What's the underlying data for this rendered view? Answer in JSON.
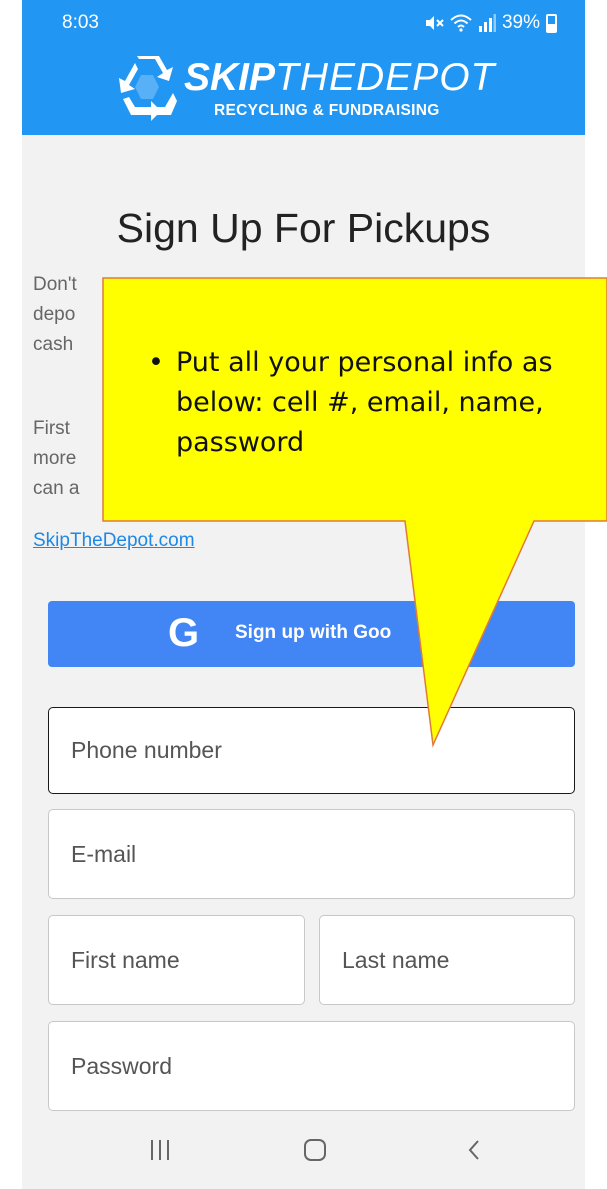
{
  "status_bar": {
    "time": "8:03",
    "battery": "39%"
  },
  "header": {
    "brand_bold": "SKIP",
    "brand_light": "THEDEPOT",
    "tagline": "RECYCLING & FUNDRAISING",
    "background": "#2196f3"
  },
  "page": {
    "title": "Sign Up For Pickups",
    "paragraph_1": "Don't",
    "paragraph_1_line_2": "depo",
    "paragraph_1_line_3": "cash",
    "paragraph_2_line_1": "First",
    "paragraph_2_line_2": "more",
    "paragraph_2_line_3": "can a",
    "link_text": "SkipTheDepot.com"
  },
  "google_button": {
    "icon": "G",
    "label": "Sign up with Goo"
  },
  "form": {
    "phone_placeholder": "Phone number",
    "email_placeholder": "E-mail",
    "first_name_placeholder": "First name",
    "last_name_placeholder": "Last name",
    "password_placeholder": "Password"
  },
  "navbar": {
    "recent_icon": "recent-apps-icon",
    "home_icon": "home-icon",
    "back_icon": "back-icon",
    "back_glyph": "<"
  },
  "annotation": {
    "bullet": "•",
    "text": "Put all your personal info as below: cell #, email, name, password",
    "fill": "#ffff00",
    "stroke": "#e07b39"
  }
}
